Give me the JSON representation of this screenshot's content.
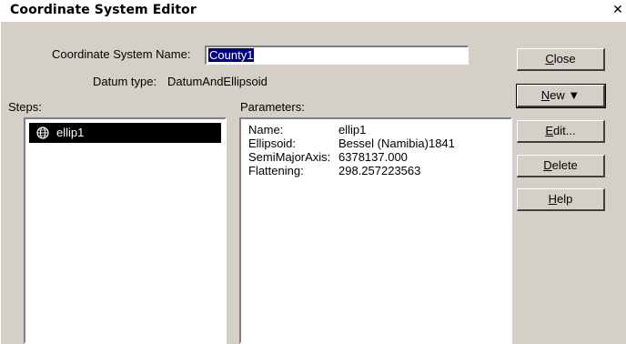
{
  "window": {
    "title": "Coordinate System Editor",
    "close_glyph": "✕"
  },
  "form": {
    "name_label": "Coordinate System Name:",
    "name_value": "County1",
    "datum_type_label": "Datum type:",
    "datum_type_value": "DatumAndEllipsoid"
  },
  "steps": {
    "label": "Steps:",
    "items": [
      {
        "label": "ellip1",
        "icon": "globe-icon",
        "selected": true
      }
    ]
  },
  "parameters": {
    "label": "Parameters:",
    "rows": [
      {
        "key": "Name:",
        "value": "ellip1"
      },
      {
        "key": "Ellipsoid:",
        "value": "Bessel (Namibia)1841"
      },
      {
        "key": "SemiMajorAxis:",
        "value": "6378137.000"
      },
      {
        "key": "Flattening:",
        "value": "298.257223563"
      }
    ]
  },
  "buttons": {
    "close": {
      "mnemonic": "C",
      "rest": "lose"
    },
    "new": {
      "mnemonic": "N",
      "rest": "ew ▼"
    },
    "edit": {
      "mnemonic": "E",
      "rest": "dit..."
    },
    "delete": {
      "mnemonic": "D",
      "rest": "elete"
    },
    "help": {
      "mnemonic": "H",
      "rest": "elp"
    }
  },
  "colors": {
    "face": "#d4d0c8",
    "selection": "#000080",
    "list_selection": "#000000"
  }
}
